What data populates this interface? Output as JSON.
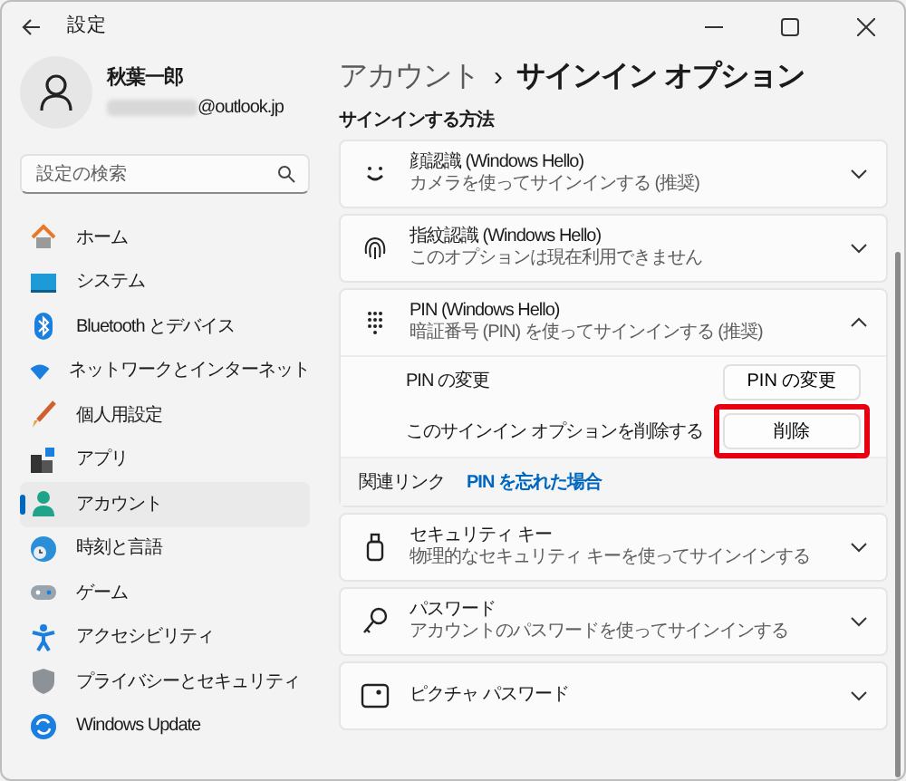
{
  "window": {
    "title": "設定"
  },
  "profile": {
    "name": "秋葉一郎",
    "email": "@outlook.jp"
  },
  "search": {
    "placeholder": "設定の検索"
  },
  "sidebar": {
    "items": [
      {
        "label": "ホーム",
        "selected": false
      },
      {
        "label": "システム",
        "selected": false
      },
      {
        "label": "Bluetooth とデバイス",
        "selected": false
      },
      {
        "label": "ネットワークとインターネット",
        "selected": false
      },
      {
        "label": "個人用設定",
        "selected": false
      },
      {
        "label": "アプリ",
        "selected": false
      },
      {
        "label": "アカウント",
        "selected": true
      },
      {
        "label": "時刻と言語",
        "selected": false
      },
      {
        "label": "ゲーム",
        "selected": false
      },
      {
        "label": "アクセシビリティ",
        "selected": false
      },
      {
        "label": "プライバシーとセキュリティ",
        "selected": false
      },
      {
        "label": "Windows Update",
        "selected": false
      }
    ]
  },
  "breadcrumb": {
    "parent": "アカウント",
    "separator": "›",
    "current": "サインイン オプション"
  },
  "section_title": "サインインする方法",
  "methods": [
    {
      "title": "顔認識 (Windows Hello)",
      "subtitle": "カメラを使ってサインインする (推奨)",
      "expanded": false
    },
    {
      "title": "指紋認識 (Windows Hello)",
      "subtitle": "このオプションは現在利用できません",
      "expanded": false
    },
    {
      "title": "PIN (Windows Hello)",
      "subtitle": "暗証番号 (PIN) を使ってサインインする (推奨)",
      "expanded": true,
      "settings": [
        {
          "label": "PIN の変更",
          "button": "PIN の変更",
          "highlighted": false
        },
        {
          "label": "このサインイン オプションを削除する",
          "button": "削除",
          "highlighted": true
        }
      ],
      "related": {
        "label": "関連リンク",
        "link": "PIN を忘れた場合"
      }
    },
    {
      "title": "セキュリティ キー",
      "subtitle": "物理的なセキュリティ キーを使ってサインインする",
      "expanded": false
    },
    {
      "title": "パスワード",
      "subtitle": "アカウントのパスワードを使ってサインインする",
      "expanded": false
    },
    {
      "title": "ピクチャ パスワード",
      "expanded": false
    }
  ]
}
